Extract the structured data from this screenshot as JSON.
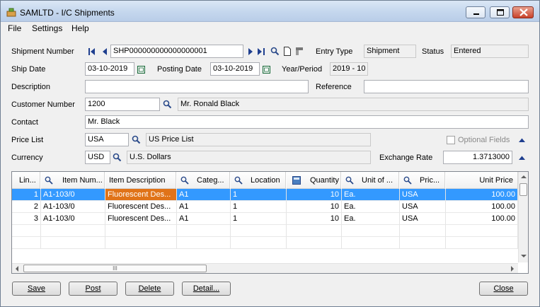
{
  "window": {
    "title": "SAMLTD - I/C Shipments"
  },
  "menu": {
    "file": "File",
    "settings": "Settings",
    "help": "Help"
  },
  "form": {
    "shipment_number_label": "Shipment Number",
    "shipment_number": "SHP000000000000000001",
    "entry_type_label": "Entry Type",
    "entry_type": "Shipment",
    "status_label": "Status",
    "status": "Entered",
    "ship_date_label": "Ship Date",
    "ship_date": "03-10-2019",
    "posting_date_label": "Posting Date",
    "posting_date": "03-10-2019",
    "year_period_label": "Year/Period",
    "year_period": "2019 - 10",
    "description_label": "Description",
    "description": "",
    "reference_label": "Reference",
    "reference": "",
    "customer_number_label": "Customer Number",
    "customer_number": "1200",
    "customer_name": "Mr. Ronald Black",
    "contact_label": "Contact",
    "contact": "Mr. Black",
    "price_list_label": "Price List",
    "price_list": "USA",
    "price_list_desc": "US Price List",
    "optional_fields_label": "Optional Fields",
    "currency_label": "Currency",
    "currency": "USD",
    "currency_desc": "U.S. Dollars",
    "exchange_rate_label": "Exchange Rate",
    "exchange_rate": "1.3713000"
  },
  "grid": {
    "headers": [
      "Lin...",
      "Item Num...",
      "Item Description",
      "Categ...",
      "Location",
      "Quantity",
      "Unit of ...",
      "Pric...",
      "Unit Price"
    ],
    "rows": [
      [
        "1",
        "A1-103/0",
        "Fluorescent Des...",
        "A1",
        "1",
        "10",
        "Ea.",
        "USA",
        "100.00"
      ],
      [
        "2",
        "A1-103/0",
        "Fluorescent Des...",
        "A1",
        "1",
        "10",
        "Ea.",
        "USA",
        "100.00"
      ],
      [
        "3",
        "A1-103/0",
        "Fluorescent Des...",
        "A1",
        "1",
        "10",
        "Ea.",
        "USA",
        "100.00"
      ]
    ],
    "hscroll_grip": "III"
  },
  "buttons": {
    "save": "Save",
    "post": "Post",
    "delete": "Delete",
    "detail": "Detail...",
    "close": "Close"
  },
  "colors": {
    "selection": "#3399ff",
    "selected_cell": "#e07318",
    "titlebar": "#c6d8ee"
  },
  "icons": [
    "app-icon",
    "first-record-icon",
    "previous-icon",
    "next-icon",
    "last-record-icon",
    "finder-icon",
    "new-document-icon",
    "settings-icon",
    "calendar-icon",
    "expand-up-icon",
    "minimize-icon",
    "maximize-icon",
    "close-icon"
  ]
}
